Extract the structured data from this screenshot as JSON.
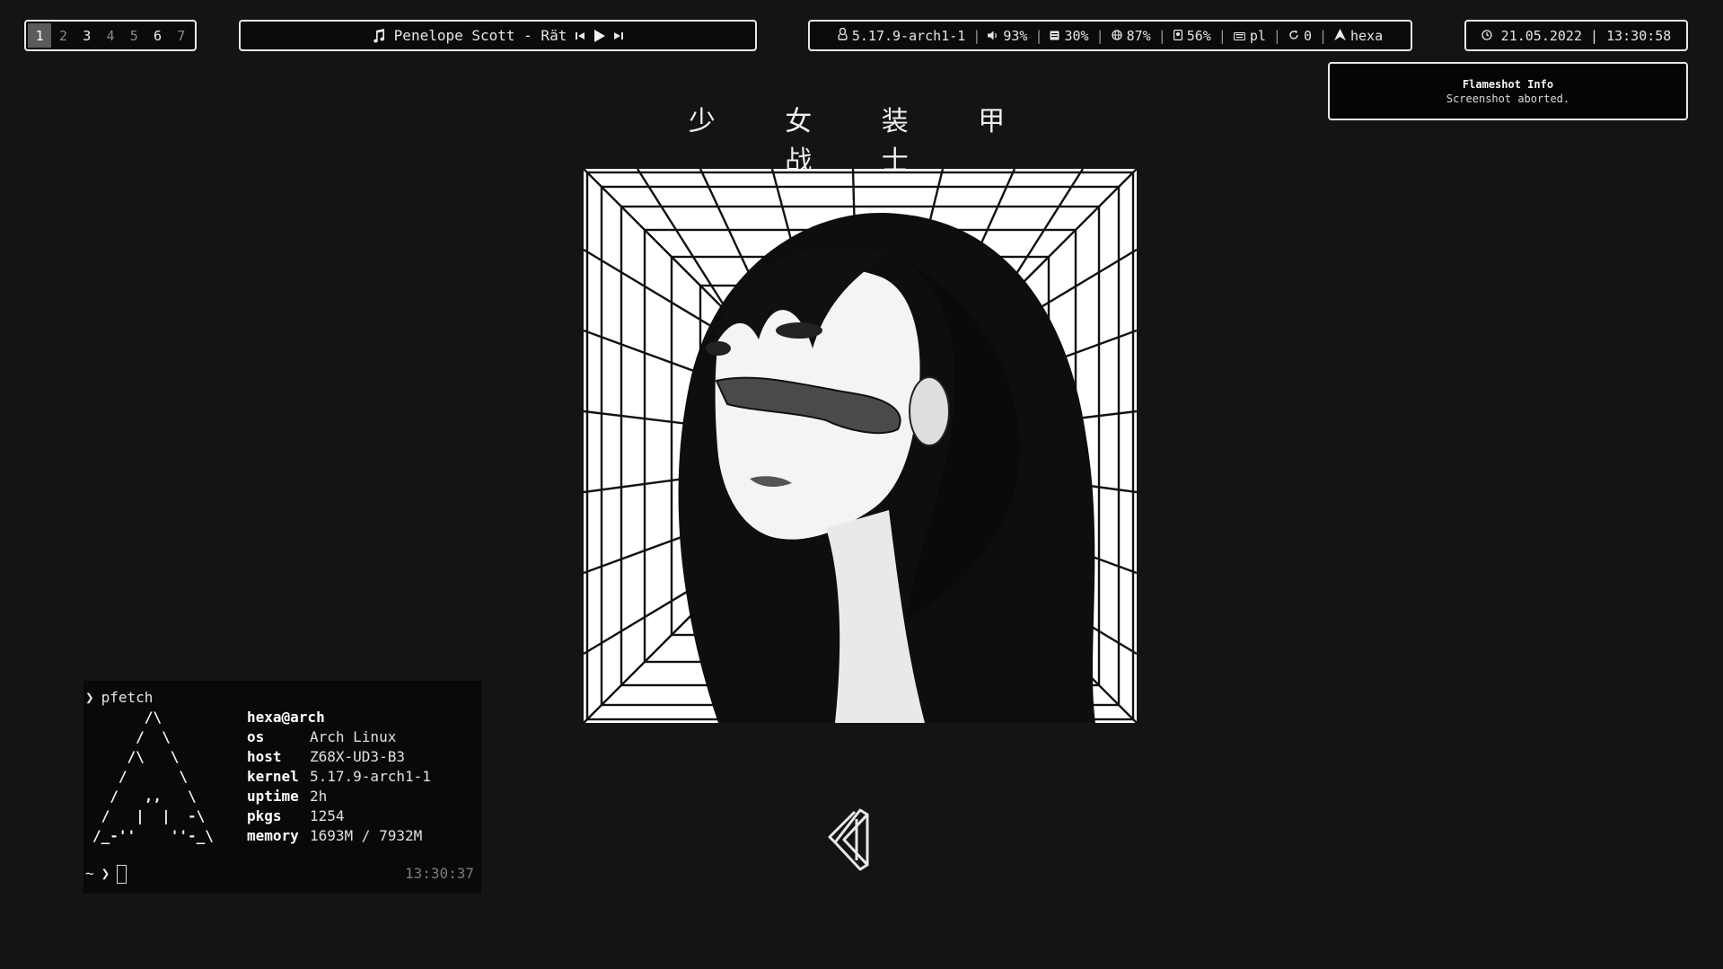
{
  "workspaces": [
    {
      "label": "1",
      "state": "active"
    },
    {
      "label": "2",
      "state": "empty"
    },
    {
      "label": "3",
      "state": "occupied"
    },
    {
      "label": "4",
      "state": "empty"
    },
    {
      "label": "5",
      "state": "empty"
    },
    {
      "label": "6",
      "state": "occupied"
    },
    {
      "label": "7",
      "state": "empty"
    }
  ],
  "music": {
    "track": "Penelope Scott - Rät",
    "icons": {
      "note": "music-note-icon",
      "prev": "previous-track-icon",
      "play": "play-icon",
      "next": "next-track-icon"
    }
  },
  "status": {
    "kernel": "5.17.9-arch1-1",
    "volume": "93%",
    "cpu": "30%",
    "network": "87%",
    "disk": "56%",
    "keyboard_layout": "pl",
    "updates": "0",
    "user": "hexa",
    "separator": "|"
  },
  "clock": {
    "text": "21.05.2022 | 13:30:58"
  },
  "notification": {
    "title": "Flameshot Info",
    "body": "Screenshot aborted."
  },
  "wallpaper": {
    "title": "少 女 装 甲 战 士"
  },
  "terminal": {
    "command_arrow": "❯",
    "command": "pfetch",
    "ascii_art": "      /\\\n     /  \\\n    /\\   \\\n   /      \\\n  /   ,,   \\\n /   |  |  -\\\n/_-''    ''-_\\",
    "user_host": "hexa@arch",
    "rows": [
      {
        "key": "os",
        "value": "Arch Linux"
      },
      {
        "key": "host",
        "value": "Z68X-UD3-B3"
      },
      {
        "key": "kernel",
        "value": "5.17.9-arch1-1"
      },
      {
        "key": "uptime",
        "value": "2h"
      },
      {
        "key": "pkgs",
        "value": "1254"
      },
      {
        "key": "memory",
        "value": "1693M / 7932M"
      }
    ],
    "prompt_dir": "~",
    "prompt_arrow": "❯",
    "time": "13:30:37"
  },
  "colors": {
    "background": "#141414",
    "foreground": "#e6e6e6",
    "border": "#e8e8e8",
    "active_ws": "#5b5b5b"
  }
}
